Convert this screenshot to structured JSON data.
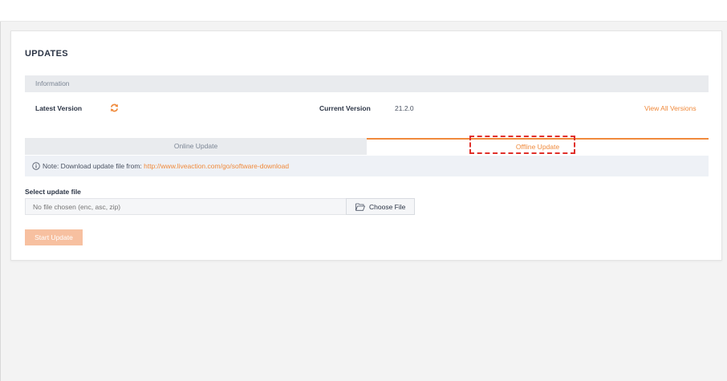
{
  "page": {
    "title": "UPDATES"
  },
  "information": {
    "header": "Information",
    "latest_version_label": "Latest Version",
    "refresh_icon": "refresh-icon",
    "current_version_label": "Current Version",
    "current_version_value": "21.2.0",
    "view_all_link": "View All Versions"
  },
  "tabs": [
    {
      "label": "Online Update",
      "active": false
    },
    {
      "label": "Offline Update",
      "active": true
    }
  ],
  "note": {
    "icon": "info-icon",
    "text": "Note: Download update file from: ",
    "link": "http://www.liveaction.com/go/software-download"
  },
  "file_select": {
    "label": "Select update file",
    "placeholder": "No file chosen (enc, asc, zip)",
    "value": "",
    "button_label": "Choose File",
    "button_icon": "folder-open-icon"
  },
  "actions": {
    "start_label": "Start Update",
    "start_enabled": false
  },
  "colors": {
    "accent": "#f08a3c",
    "highlight_outline": "#e0302b",
    "disabled_button": "#f7c0a0"
  }
}
